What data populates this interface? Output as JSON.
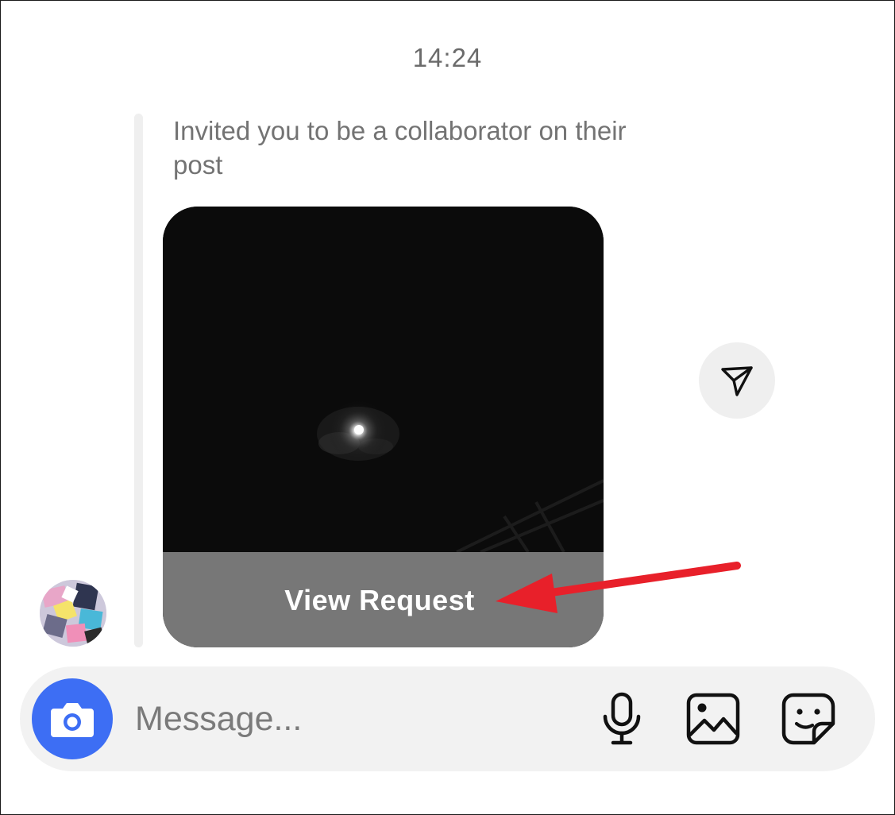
{
  "thread": {
    "timestamp": "14:24",
    "invite_text": "Invited you to be a collaborator on their post"
  },
  "post": {
    "cta_label": "View Request",
    "share_icon": "paper-plane-icon"
  },
  "composer": {
    "placeholder": "Message...",
    "camera_icon": "camera-icon",
    "mic_icon": "microphone-icon",
    "gallery_icon": "gallery-icon",
    "sticker_icon": "sticker-icon"
  },
  "annotation": {
    "arrow_color": "#e8202a"
  },
  "colors": {
    "accent_blue": "#3d6ef4",
    "overlay_gray": "#777777",
    "bubble_gray": "#efefef"
  }
}
